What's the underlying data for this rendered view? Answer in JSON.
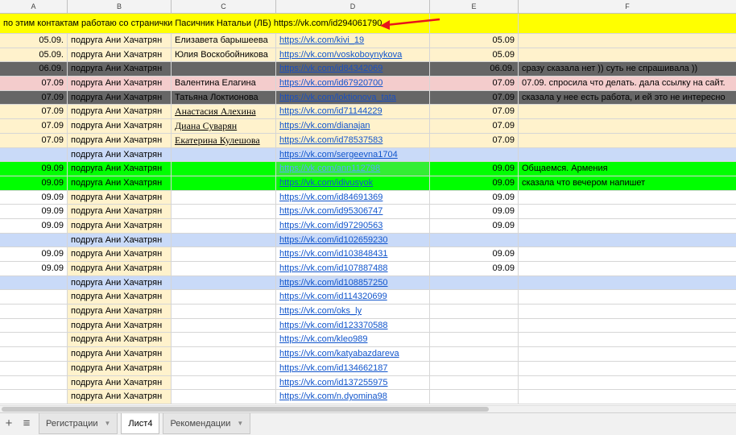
{
  "columns": [
    "A",
    "B",
    "C",
    "D",
    "E",
    "F"
  ],
  "header_note": "по этим контактам работаю со странички Пасичник Натальи (ЛБ) https://vk.com/id294061790",
  "colors": {
    "yellow": "#ffff00",
    "beige": "#fff2cc",
    "gray": "#666666",
    "pink": "#f4cccc",
    "blue": "#c9daf8",
    "green": "#00ff00",
    "white": "#ffffff"
  },
  "rows": [
    {
      "bg": "beige",
      "a": "05.09.",
      "b": "подруга Ани Хачатрян",
      "c": "Елизавета барышеева",
      "d": "https://vk.com/kivi_19",
      "e": "05.09",
      "f": "",
      "cstyle": ""
    },
    {
      "bg": "beige",
      "a": "05.09.",
      "b": "подруга Ани Хачатрян",
      "c": "Юлия Воскобойникова",
      "d": "https://vk.com/voskoboynykova",
      "e": "05.09",
      "f": "",
      "cstyle": ""
    },
    {
      "bg": "gray",
      "a": "06.09.",
      "b": "подруга Ани Хачатрян",
      "c": "",
      "d": "https://vk.com/id84342069",
      "e": "06.09.",
      "f": "сразу сказала нет )) суть не спрашивала ))",
      "cstyle": ""
    },
    {
      "bg": "pink",
      "a": "07.09",
      "b": "подруга Ани Хачатрян",
      "c": "Валентина Елагина",
      "d": "https://vk.com/id67920700",
      "e": "07.09",
      "f": "07.09. спросила что делать. дала ссылку на сайт.",
      "cstyle": ""
    },
    {
      "bg": "gray",
      "a": "07.09",
      "b": "подруга Ани Хачатрян",
      "c": "Татьяна Локтионова",
      "d": "https://vk.com/loktionova_tata",
      "e": "07.09",
      "f": "сказала у нее есть работа, и ей это не интересно",
      "cstyle": ""
    },
    {
      "bg": "beige",
      "a": "07.09",
      "b": "подруга Ани Хачатрян",
      "c": "Анастасия Алехина",
      "d": "https://vk.com/id71144229",
      "e": "07.09",
      "f": "",
      "cstyle": "ul"
    },
    {
      "bg": "beige",
      "a": "07.09",
      "b": "подруга Ани Хачатрян",
      "c": "Диана Суварян",
      "d": "https://vk.com/dianajan",
      "e": "07.09",
      "f": "",
      "cstyle": "ul"
    },
    {
      "bg": "beige",
      "a": "07.09",
      "b": "подруга Ани Хачатрян",
      "c": "Екатерина Кулешова",
      "d": "https://vk.com/id78537583",
      "e": "07.09",
      "f": "",
      "cstyle": "ul"
    },
    {
      "bg": "blue",
      "a": "",
      "b": "подруга Ани Хачатрян",
      "c": "",
      "d": "https://vk.com/sergeevna1704",
      "e": "",
      "f": "",
      "cstyle": ""
    },
    {
      "bg": "green",
      "a": "09.09",
      "b": "подруга Ани Хачатрян",
      "c": "",
      "d": "https://vk.com/ann112798",
      "e": "09.09",
      "f": "Общаемся. Армения",
      "cstyle": ""
    },
    {
      "bg": "green",
      "a": "09.09",
      "b": "подруга Ани Хачатрян",
      "c": "",
      "d": "https://vk.com/idivusyok",
      "e": "09.09",
      "f": "сказала что вечером напишет",
      "cstyle": ""
    },
    {
      "bg": "white",
      "a": "09.09",
      "b": "подруга Ани Хачатрян",
      "c": "",
      "d": "https://vk.com/id84691369",
      "e": "09.09",
      "f": "",
      "cstyle": ""
    },
    {
      "bg": "white",
      "a": "09.09",
      "b": "подруга Ани Хачатрян",
      "c": "",
      "d": "https://vk.com/id95306747",
      "e": "09.09",
      "f": "",
      "cstyle": ""
    },
    {
      "bg": "white",
      "a": "09.09",
      "b": "подруга Ани Хачатрян",
      "c": "",
      "d": "https://vk.com/id97290563",
      "e": "09.09",
      "f": "",
      "cstyle": ""
    },
    {
      "bg": "blue",
      "a": "",
      "b": "подруга Ани Хачатрян",
      "c": "",
      "d": "https://vk.com/id102659230",
      "e": "",
      "f": "",
      "cstyle": ""
    },
    {
      "bg": "white",
      "a": "09.09",
      "b": "подруга Ани Хачатрян",
      "c": "",
      "d": "https://vk.com/id103848431",
      "e": "09.09",
      "f": "",
      "cstyle": ""
    },
    {
      "bg": "white",
      "a": "09.09",
      "b": "подруга Ани Хачатрян",
      "c": "",
      "d": "https://vk.com/id107887488",
      "e": "09.09",
      "f": "",
      "cstyle": ""
    },
    {
      "bg": "blue",
      "a": "",
      "b": "подруга Ани Хачатрян",
      "c": "",
      "d": "https://vk.com/id108857250",
      "e": "",
      "f": "",
      "cstyle": ""
    },
    {
      "bg": "white",
      "a": "",
      "b": "подруга Ани Хачатрян",
      "c": "",
      "d": "https://vk.com/id114320699",
      "e": "",
      "f": "",
      "cstyle": ""
    },
    {
      "bg": "white",
      "a": "",
      "b": "подруга Ани Хачатрян",
      "c": "",
      "d": "https://vk.com/oks_ly",
      "e": "",
      "f": "",
      "cstyle": ""
    },
    {
      "bg": "white",
      "a": "",
      "b": "подруга Ани Хачатрян",
      "c": "",
      "d": "https://vk.com/id123370588",
      "e": "",
      "f": "",
      "cstyle": ""
    },
    {
      "bg": "white",
      "a": "",
      "b": "подруга Ани Хачатрян",
      "c": "",
      "d": "https://vk.com/kleo989",
      "e": "",
      "f": "",
      "cstyle": ""
    },
    {
      "bg": "white",
      "a": "",
      "b": "подруга Ани Хачатрян",
      "c": "",
      "d": "https://vk.com/katyabazdareva",
      "e": "",
      "f": "",
      "cstyle": ""
    },
    {
      "bg": "white",
      "a": "",
      "b": "подруга Ани Хачатрян",
      "c": "",
      "d": "https://vk.com/id134662187",
      "e": "",
      "f": "",
      "cstyle": ""
    },
    {
      "bg": "white",
      "a": "",
      "b": "подруга Ани Хачатрян",
      "c": "",
      "d": "https://vk.com/id137255975",
      "e": "",
      "f": "",
      "cstyle": ""
    },
    {
      "bg": "white",
      "a": "",
      "b": "подруга Ани Хачатрян",
      "c": "",
      "d": "https://vk.com/n.dyomina98",
      "e": "",
      "f": "",
      "cstyle": ""
    }
  ],
  "tabs": [
    {
      "label": "Регистрации",
      "active": false
    },
    {
      "label": "Лист4",
      "active": true
    },
    {
      "label": "Рекомендации",
      "active": false
    }
  ],
  "icons": {
    "add": "plus-icon",
    "all_sheets": "menu-icon"
  }
}
